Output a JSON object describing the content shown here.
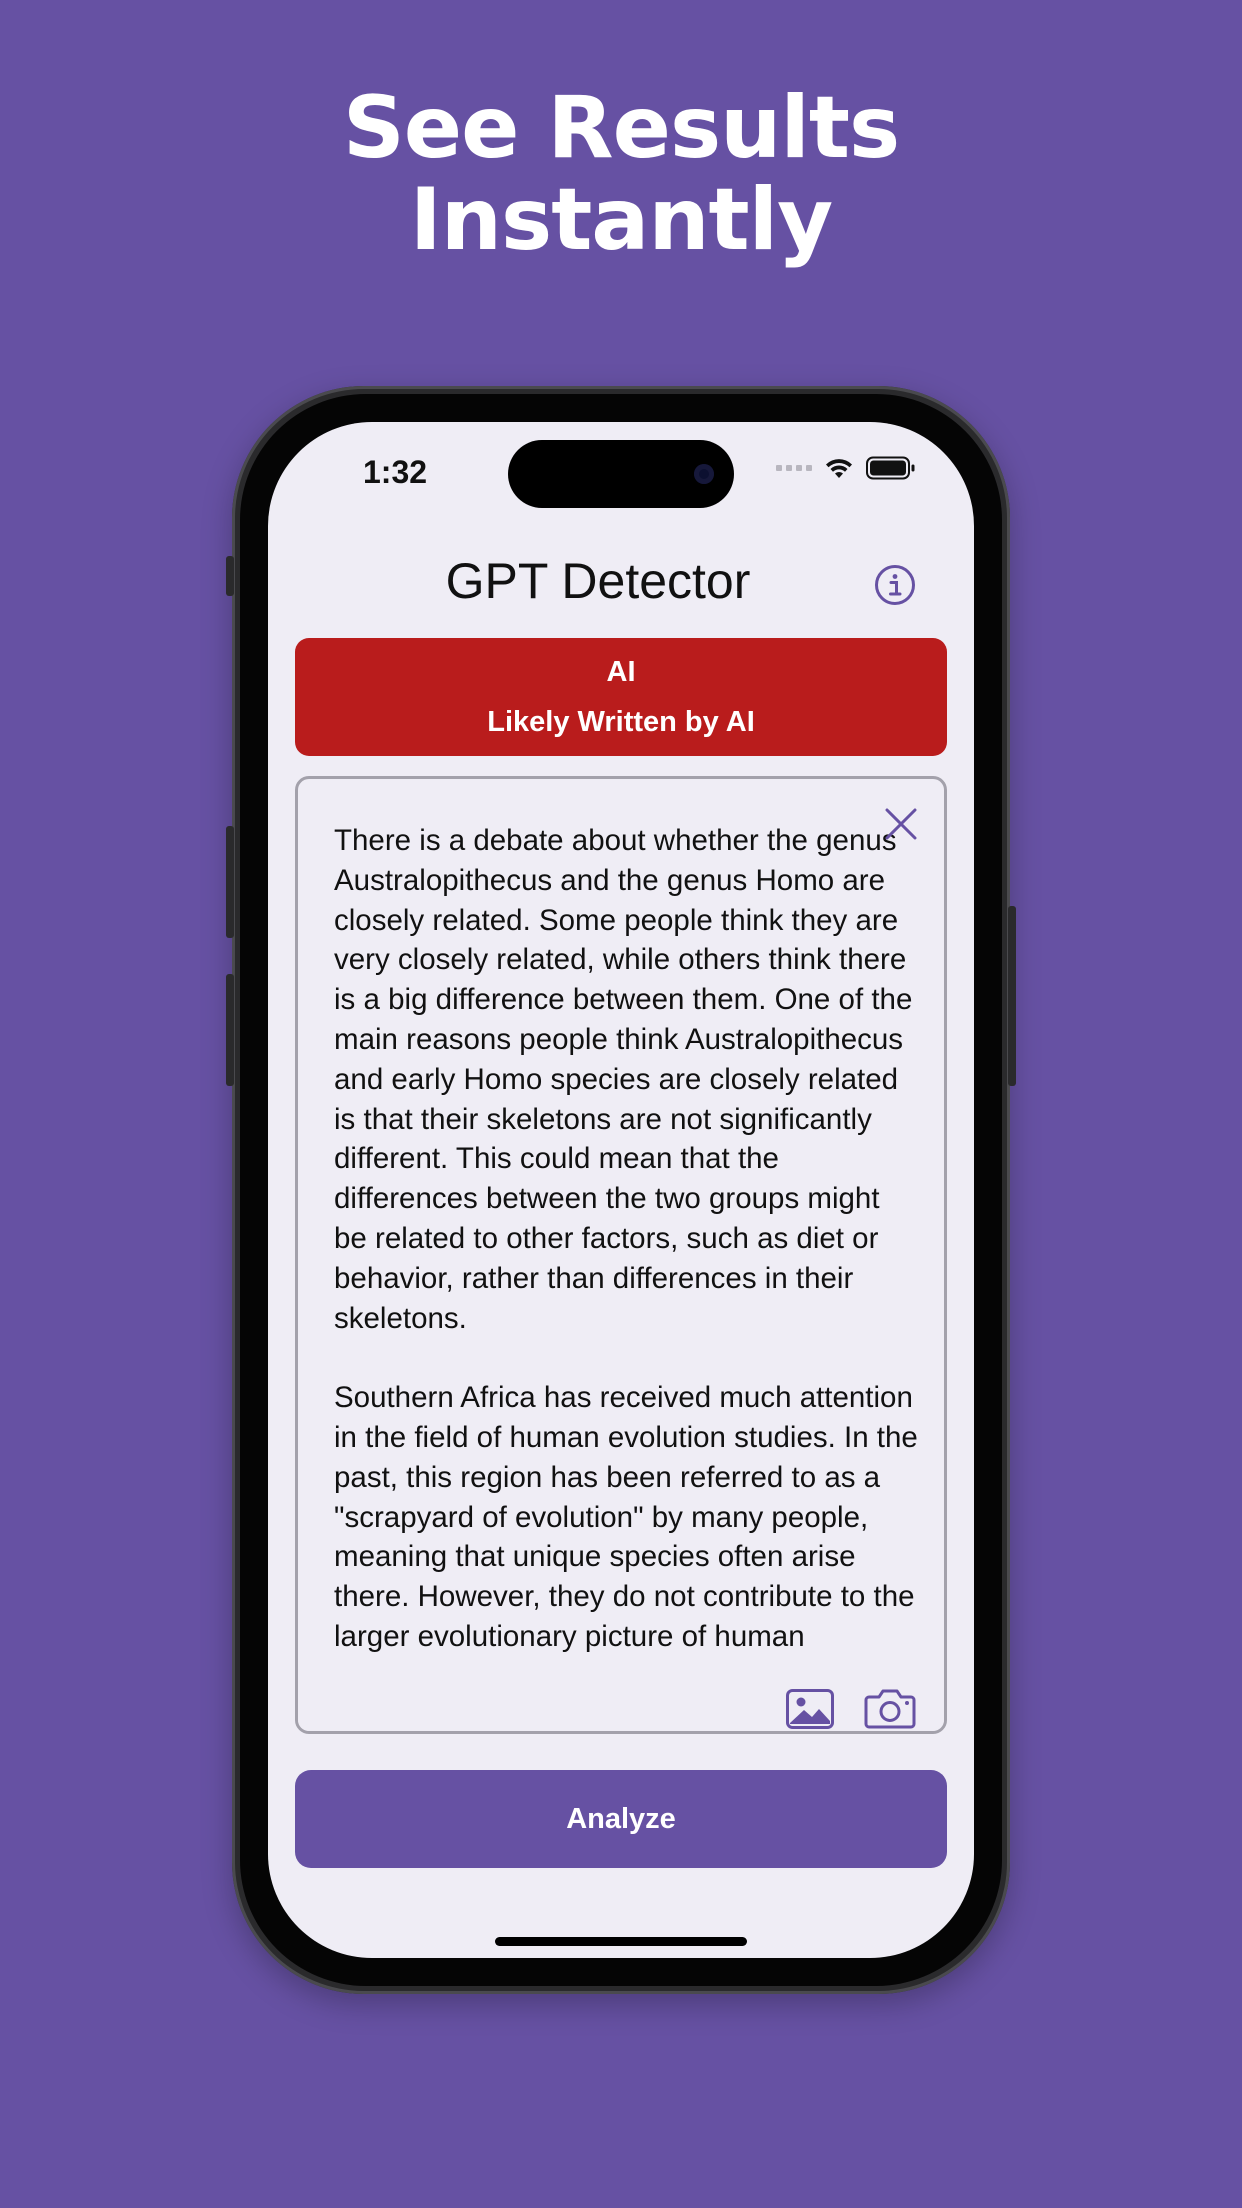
{
  "headline": {
    "line1": "See Results",
    "line2": "Instantly"
  },
  "status_bar": {
    "time": "1:32"
  },
  "nav": {
    "title": "GPT Detector"
  },
  "result": {
    "label": "AI",
    "description": "Likely Written by AI"
  },
  "input_text": "There is a debate about whether the genus Australopithecus and the genus Homo are closely related. Some people think they are very closely related, while others think there is a big difference between them. One of the main reasons people think Australopithecus and early Homo species are closely related is that their skeletons are not significantly different. This could mean that the differences between the two groups might be related to other factors, such as diet or behavior, rather than differences in their skeletons.\n\nSouthern Africa has received much attention in the field of human evolution studies. In the past, this region has been referred to as a \"scrapyard of evolution\" by many people, meaning that unique species often arise there. However, they do not contribute to the larger evolutionary picture of human",
  "actions": {
    "analyze_label": "Analyze"
  },
  "colors": {
    "background": "#6651a3",
    "accent": "#6651a3",
    "result_ai": "#b91c1c",
    "screen": "#efedf5"
  },
  "icons": {
    "info": "info-circle-icon",
    "close": "close-icon",
    "photo": "photo-library-icon",
    "camera": "camera-icon",
    "wifi": "wifi-icon",
    "battery": "battery-icon"
  }
}
